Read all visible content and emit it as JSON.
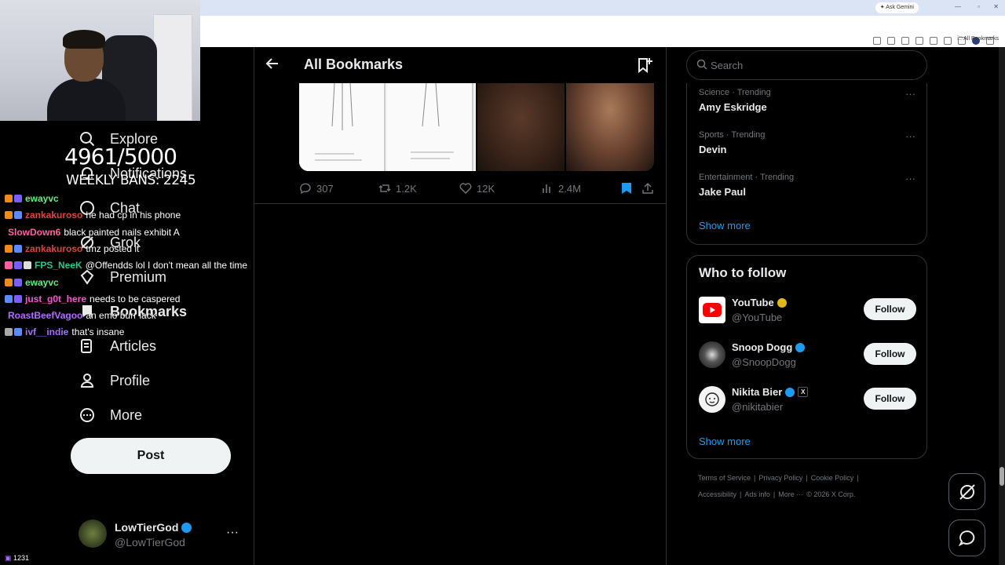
{
  "browser": {
    "ask_gemini": "✦ Ask Gemini",
    "bookmarks_folder": "All Bookmarks"
  },
  "stream_overlay": {
    "ban_count": "4961/5000",
    "weekly_bans": "WEEKLY BANS: 2245",
    "viewer_count": "1231",
    "chat": [
      {
        "user": "ewayvc",
        "color": "#5bf07a",
        "text": ""
      },
      {
        "user": "zankakuroso",
        "color": "#e0423b",
        "text": "he had cp in his phone"
      },
      {
        "user": "SlowDown6",
        "color": "#ff5fa2",
        "text": "black painted nails exhibit A"
      },
      {
        "user": "zankakuroso",
        "color": "#e0423b",
        "text": "tmz posted it"
      },
      {
        "user": "FPS_NeeK",
        "color": "#1ec98a",
        "text": "@Offendds lol I don't mean all the time"
      },
      {
        "user": "ewayvc",
        "color": "#5bf07a",
        "text": ""
      },
      {
        "user": "just_g0t_here",
        "color": "#ff4fd8",
        "text": "needs to be caspered"
      },
      {
        "user": "RoastBeefVagoo",
        "color": "#b26cff",
        "text": "an emo burr lack"
      },
      {
        "user": "ivf__indie",
        "color": "#a66bff",
        "text": "that's insane"
      }
    ]
  },
  "nav": {
    "items": [
      {
        "label": "Explore",
        "icon": "search-icon"
      },
      {
        "label": "Notifications",
        "icon": "bell-icon"
      },
      {
        "label": "Chat",
        "icon": "chat-icon"
      },
      {
        "label": "Grok",
        "icon": "grok-icon"
      },
      {
        "label": "Premium",
        "icon": "premium-icon"
      },
      {
        "label": "Bookmarks",
        "icon": "bookmark-icon"
      },
      {
        "label": "Articles",
        "icon": "articles-icon"
      },
      {
        "label": "Profile",
        "icon": "profile-icon"
      },
      {
        "label": "More",
        "icon": "more-circle-icon"
      }
    ],
    "post_label": "Post",
    "account": {
      "name": "LowTierGod",
      "handle": "@LowTierGod"
    }
  },
  "main": {
    "title": "All Bookmarks",
    "tweet_stats": {
      "replies": "307",
      "reposts": "1.2K",
      "likes": "12K",
      "views": "2.4M"
    }
  },
  "sidebar": {
    "search_placeholder": "Search",
    "trends": [
      {
        "meta": "Science · Trending",
        "title": "Amy Eskridge"
      },
      {
        "meta": "Sports · Trending",
        "title": "Devin"
      },
      {
        "meta": "Entertainment · Trending",
        "title": "Jake Paul"
      }
    ],
    "trends_show_more": "Show more",
    "who_to_follow_title": "Who to follow",
    "who_to_follow": [
      {
        "name": "YouTube",
        "handle": "@YouTube",
        "follow": "Follow"
      },
      {
        "name": "Snoop Dogg",
        "handle": "@SnoopDogg",
        "follow": "Follow"
      },
      {
        "name": "Nikita Bier",
        "handle": "@nikitabier",
        "follow": "Follow"
      }
    ],
    "wtf_show_more": "Show more",
    "footer_row1": [
      "Terms of Service",
      "|",
      "Privacy Policy",
      "|",
      "Cookie Policy",
      "|"
    ],
    "footer_row2": [
      "Accessibility",
      "|",
      "Ads info",
      "|",
      "More ···",
      "© 2026 X Corp."
    ]
  },
  "colors": {
    "accent": "#1d9bf0",
    "verified_gold": "#e2b719",
    "verified_blue": "#1d9bf0"
  }
}
